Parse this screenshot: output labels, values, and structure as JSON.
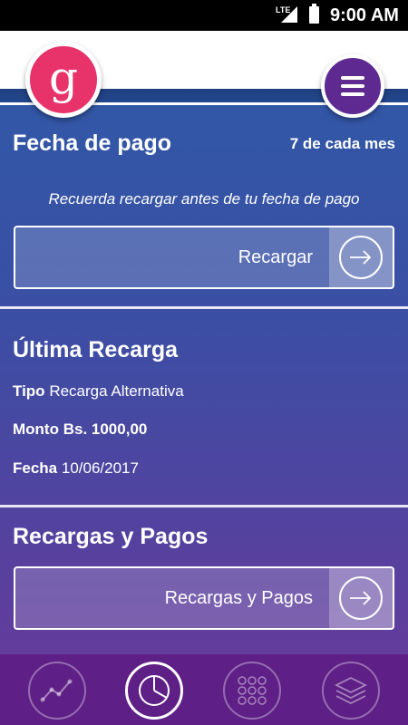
{
  "status_bar": {
    "network": "LTE",
    "time": "9:00 AM"
  },
  "header": {
    "logo_glyph": "g",
    "logo_icon": "logo-icon",
    "menu_icon": "hamburger-menu-icon"
  },
  "payment": {
    "title": "Fecha de pago",
    "due": "7 de cada mes",
    "reminder": "Recuerda recargar antes de tu fecha de pago",
    "button_label": "Recargar"
  },
  "last_recharge": {
    "title": "Última Recarga",
    "type_label": "Tipo",
    "type_value": "Recarga Alternativa",
    "amount_label": "Monto",
    "amount_value": "Bs. 1000,00",
    "date_label": "Fecha",
    "date_value": "10/06/2017"
  },
  "recharges_payments": {
    "title": "Recargas y Pagos",
    "button_label": "Recargas y Pagos"
  },
  "bottom_nav": [
    {
      "icon": "line-chart-icon",
      "active": false
    },
    {
      "icon": "pie-chart-icon",
      "active": true
    },
    {
      "icon": "grid-dots-icon",
      "active": false
    },
    {
      "icon": "layers-icon",
      "active": false
    }
  ],
  "colors": {
    "brand_pink": "#e8336a",
    "brand_purple": "#5e2a91",
    "nav_bg": "#5e1f86",
    "grad_top": "#2f5aa7",
    "grad_bottom": "#6c3a9b"
  }
}
